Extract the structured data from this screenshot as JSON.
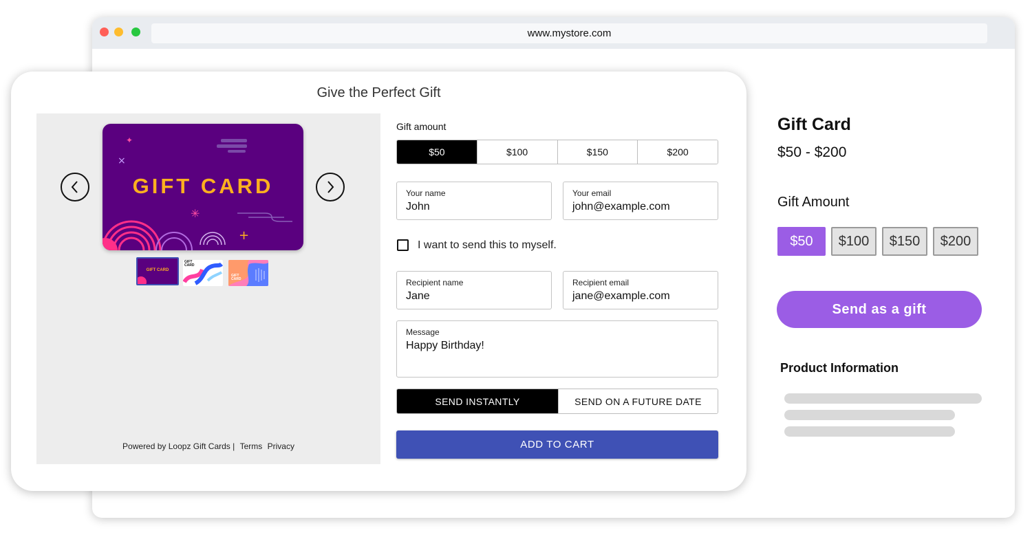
{
  "browser": {
    "url": "www.mystore.com"
  },
  "product": {
    "title": "Gift Card",
    "price_range": "$50 - $200",
    "amount_heading": "Gift Amount",
    "amounts": [
      "$50",
      "$100",
      "$150",
      "$200"
    ],
    "selected_amount": "$50",
    "gift_button": "Send as a gift",
    "info_heading": "Product Information",
    "accent_color": "#9b5de5"
  },
  "widget": {
    "title": "Give the Perfect Gift",
    "card_text": "GIFT CARD",
    "thumb2_text": "GIFT CARD",
    "thumb3_text": "GIFT CARD",
    "powered_by": "Powered by Loopz Gift Cards |",
    "terms": "Terms",
    "privacy": "Privacy",
    "gift_amount_label": "Gift amount",
    "amounts": [
      "$50",
      "$100",
      "$150",
      "$200"
    ],
    "your_name_label": "Your name",
    "your_name_value": "John",
    "your_email_label": "Your email",
    "your_email_value": "john@example.com",
    "send_to_self_label": "I want to send this to myself.",
    "send_to_self_checked": false,
    "recipient_name_label": "Recipient name",
    "recipient_name_value": "Jane",
    "recipient_email_label": "Recipient email",
    "recipient_email_value": "jane@example.com",
    "message_label": "Message",
    "message_value": "Happy Birthday!",
    "send_instantly": "SEND INSTANTLY",
    "send_future": "SEND ON A FUTURE DATE",
    "add_to_cart": "ADD TO CART",
    "button_color": "#3f51b5",
    "card_color": "#5a007f",
    "card_text_color": "#ffb01f"
  }
}
